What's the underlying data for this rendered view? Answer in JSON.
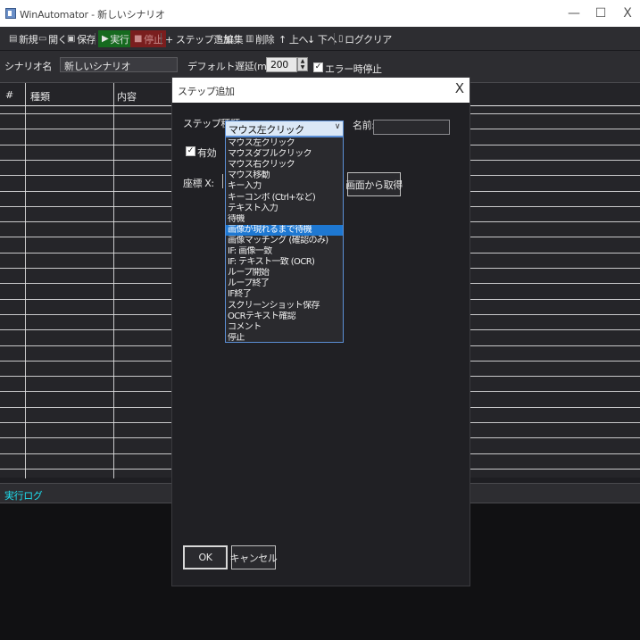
{
  "window": {
    "title": "WinAutomator - 新しいシナリオ",
    "minimize": "—",
    "maximize": "☐",
    "close": "X"
  },
  "toolbar": {
    "new": "新規",
    "open": "開く",
    "save": "保存",
    "run": "実行",
    "stop": "停止",
    "add_step": "+ ステップ追加",
    "edit": "編集",
    "delete": "削除",
    "up": "↑ 上へ",
    "down": "↓ 下へ",
    "log_clear": "ログクリア"
  },
  "settings": {
    "scenario_label": "シナリオ名",
    "scenario_value": "新しいシナリオ",
    "delay_label": "デフォルト遅延(ms):",
    "delay_value": "200",
    "stop_on_error_label": "エラー時停止",
    "stop_on_error_checked": true
  },
  "table": {
    "columns": [
      "#",
      "種類",
      "内容"
    ],
    "rows": []
  },
  "log": {
    "title": "実行ログ"
  },
  "dialog": {
    "title": "ステップ追加",
    "close": "X",
    "step_type_label": "ステップ種類",
    "step_type_value": "マウス左クリック",
    "name_label": "名前:",
    "name_value": "",
    "enabled_label": "有効",
    "enabled_checked": true,
    "coord_label": "座標 X:",
    "capture_button": "画面から取得",
    "ok": "OK",
    "cancel": "キャンセル",
    "options": [
      "マウス左クリック",
      "マウスダブルクリック",
      "マウス右クリック",
      "マウス移動",
      "キー入力",
      "キーコンボ (Ctrl+など)",
      "テキスト入力",
      "待機",
      "画像が現れるまで待機",
      "画像マッチング (確認のみ)",
      "IF: 画像一致",
      "IF: テキスト一致 (OCR)",
      "ループ開始",
      "ループ終了",
      "IF終了",
      "スクリーンショット保存",
      "OCRテキスト確認",
      "コメント",
      "停止"
    ],
    "highlighted_option": "画像が現れるまで待機"
  },
  "colors": {
    "background": "#1e1e22",
    "run_button": "#166a1f",
    "stop_button": "#7a1e1e",
    "log_title": "#1ee0f0",
    "selection": "#1e78d2",
    "combo_background": "#dbe8f6"
  },
  "icons": {
    "new": "document-icon",
    "open": "folder-open-icon",
    "save": "floppy-icon",
    "run": "play-icon",
    "stop": "stop-square-icon",
    "edit": "pencil-icon",
    "delete": "trash-icon",
    "log_clear": "clear-log-icon"
  }
}
